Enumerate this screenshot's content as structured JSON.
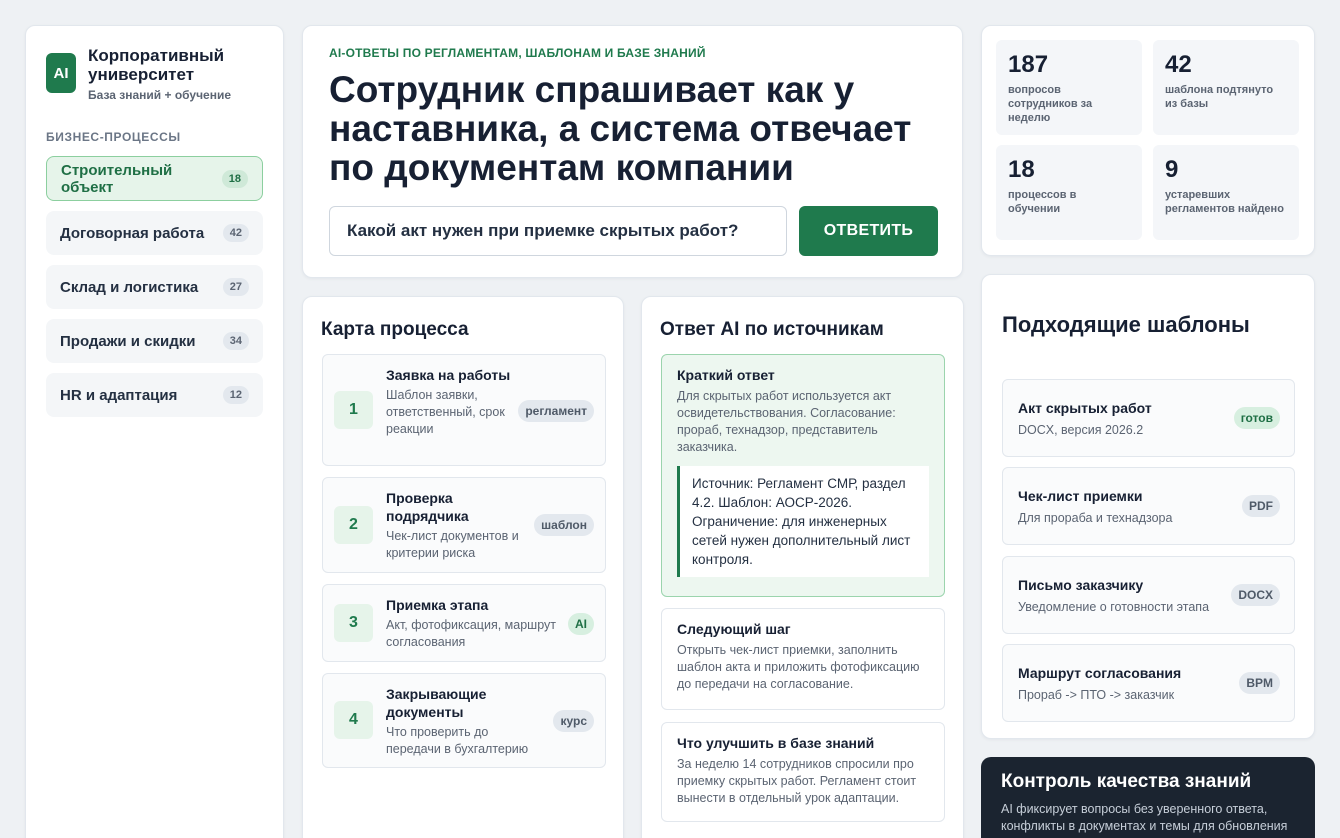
{
  "brand": {
    "logo": "AI",
    "title": "Корпоративный университет",
    "subtitle": "База знаний + обучение"
  },
  "sidebar": {
    "section_label": "БИЗНЕС-ПРОЦЕССЫ",
    "items": [
      {
        "label": "Строительный объект",
        "count": "18",
        "active": true
      },
      {
        "label": "Договорная работа",
        "count": "42"
      },
      {
        "label": "Склад и логистика",
        "count": "27"
      },
      {
        "label": "Продажи и скидки",
        "count": "34"
      },
      {
        "label": "HR и адаптация",
        "count": "12"
      }
    ]
  },
  "hero": {
    "eyebrow": "AI-ОТВЕТЫ ПО РЕГЛАМЕНТАМ, ШАБЛОНАМ И БАЗЕ ЗНАНИЙ",
    "title": "Сотрудник спрашивает как у наставника, а система отвечает по документам компании",
    "question": "Какой акт нужен при приемке скрытых работ?",
    "button": "ОТВЕТИТЬ"
  },
  "stats": [
    {
      "value": "187",
      "label": "вопросов сотрудников за неделю"
    },
    {
      "value": "42",
      "label": "шаблона подтянуто из базы"
    },
    {
      "value": "18",
      "label": "процессов в обучении"
    },
    {
      "value": "9",
      "label": "устаревших регламентов найдено"
    }
  ],
  "process": {
    "title": "Карта процесса",
    "steps": [
      {
        "num": "1",
        "title": "Заявка на работы",
        "desc": "Шаблон заявки, ответственный, срок реакции",
        "tag": "регламент"
      },
      {
        "num": "2",
        "title": "Проверка подрядчика",
        "desc": "Чек-лист документов и критерии риска",
        "tag": "шаблон"
      },
      {
        "num": "3",
        "title": "Приемка этапа",
        "desc": "Акт, фотофиксация, маршрут согласования",
        "tag": "AI"
      },
      {
        "num": "4",
        "title": "Закрывающие документы",
        "desc": "Что проверить до передачи в бухгалтерию",
        "tag": "курс"
      }
    ]
  },
  "answer": {
    "title": "Ответ AI по источникам",
    "short_title": "Краткий ответ",
    "short_text": "Для скрытых работ используется акт освидетельствования. Согласование: прораб, технадзор, представитель заказчика.",
    "source": "Источник: Регламент СМР, раздел 4.2. Шаблон: АОСР-2026. Ограничение: для инженерных сетей нужен дополнительный лист контроля.",
    "next_title": "Следующий шаг",
    "next_text": "Открыть чек-лист приемки, заполнить шаблон акта и приложить фотофиксацию до передачи на согласование.",
    "improve_title": "Что улучшить в базе знаний",
    "improve_text": "За неделю 14 сотрудников спросили про приемку скрытых работ. Регламент стоит вынести в отдельный урок адаптации."
  },
  "templates": {
    "title": "Подходящие шаблоны",
    "items": [
      {
        "name": "Акт скрытых работ",
        "meta": "DOCX, версия 2026.2",
        "tag": "готов"
      },
      {
        "name": "Чек-лист приемки",
        "meta": "Для прораба и технадзора",
        "tag": "PDF"
      },
      {
        "name": "Письмо заказчику",
        "meta": "Уведомление о готовности этапа",
        "tag": "DOCX"
      },
      {
        "name": "Маршрут согласования",
        "meta": "Прораб -> ПТО -> заказчик",
        "tag": "BPM"
      }
    ]
  },
  "quality": {
    "title": "Контроль качества знаний",
    "text": "AI фиксирует вопросы без уверенного ответа, конфликты в документах и темы для обновления"
  },
  "colors": {
    "accent": "#1f7a4d",
    "accent_light": "#e6f4ea",
    "dark_panel": "#1b2430",
    "background": "#eef1f4"
  }
}
